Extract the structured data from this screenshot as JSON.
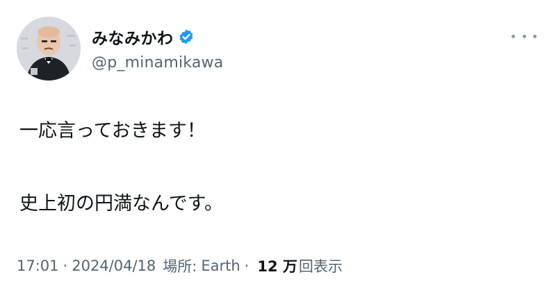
{
  "user": {
    "display_name": "みなみかわ",
    "handle": "@p_minamikawa",
    "verified": true
  },
  "tweet": {
    "line1": "一応言っておきます！",
    "line2": "史上初の円満なんです。"
  },
  "meta": {
    "time": "17:01",
    "date": "2024/04/18",
    "location_label": "場所:",
    "location": "Earth",
    "separator": "·",
    "views_count": "12 万",
    "views_label": "回表示"
  },
  "colors": {
    "verified": "#1d9bf0",
    "secondary_text": "#536471",
    "text": "#0f1419"
  }
}
